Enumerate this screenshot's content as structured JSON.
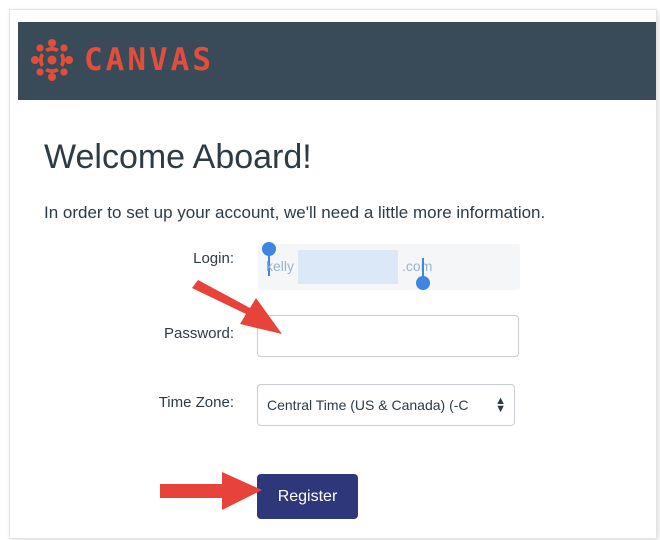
{
  "header": {
    "brand": "CANVAS",
    "brand_color": "#e34e3c",
    "bar_color": "#394b58",
    "logo_icon": "canvas-logo-icon"
  },
  "page": {
    "title": "Welcome Aboard!",
    "intro": "In order to set up your account, we'll need a little more information."
  },
  "form": {
    "login_label": "Login:",
    "login_value_prefix": "kelly",
    "login_value_suffix": ".com",
    "password_label": "Password:",
    "password_value": "",
    "timezone_label": "Time Zone:",
    "timezone_value": "Central Time (US & Canada) (-C",
    "register_label": "Register",
    "register_color": "#2e3779"
  },
  "annotations": {
    "arrow_color": "#e8433b",
    "icons": [
      "arrow-to-password-icon",
      "arrow-to-register-icon"
    ]
  }
}
